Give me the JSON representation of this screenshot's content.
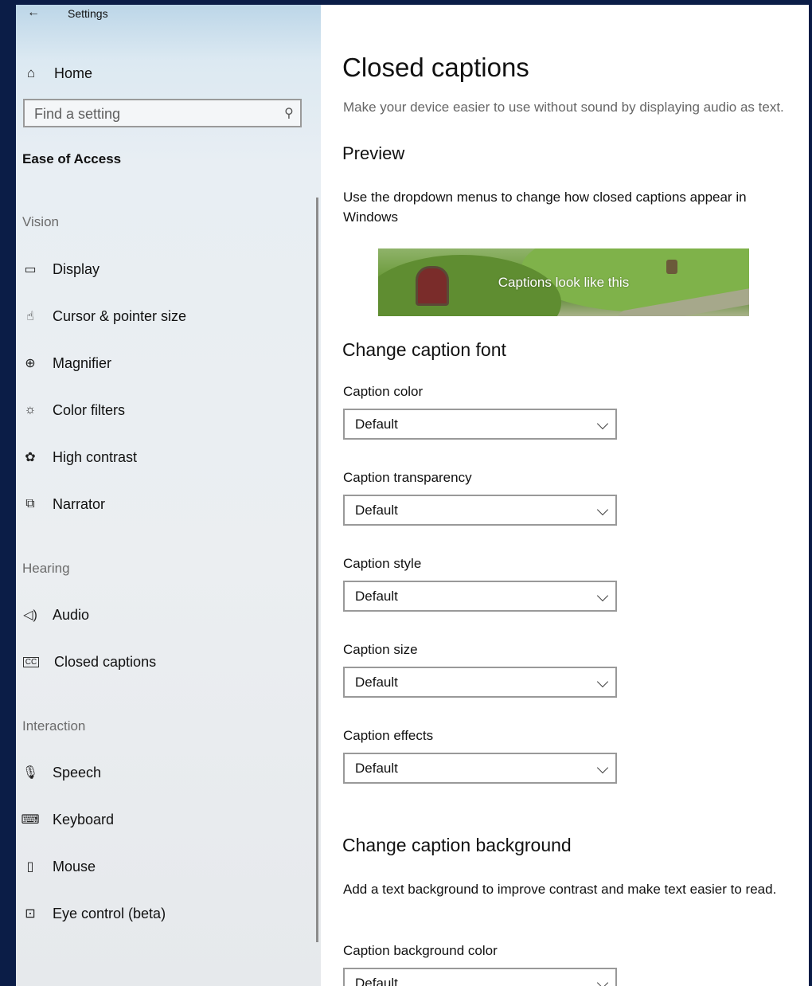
{
  "window": {
    "title": "Settings"
  },
  "sidebar": {
    "home_label": "Home",
    "search_placeholder": "Find a setting",
    "section_title": "Ease of Access",
    "groups": [
      {
        "heading": "Vision",
        "items": [
          {
            "label": "Display",
            "icon": "monitor-icon"
          },
          {
            "label": "Cursor & pointer size",
            "icon": "cursor-icon"
          },
          {
            "label": "Magnifier",
            "icon": "magnifier-icon"
          },
          {
            "label": "Color filters",
            "icon": "sun-icon"
          },
          {
            "label": "High contrast",
            "icon": "palette-icon"
          },
          {
            "label": "Narrator",
            "icon": "narrator-icon"
          }
        ]
      },
      {
        "heading": "Hearing",
        "items": [
          {
            "label": "Audio",
            "icon": "speaker-icon"
          },
          {
            "label": "Closed captions",
            "icon": "cc-icon"
          }
        ]
      },
      {
        "heading": "Interaction",
        "items": [
          {
            "label": "Speech",
            "icon": "microphone-icon"
          },
          {
            "label": "Keyboard",
            "icon": "keyboard-icon"
          },
          {
            "label": "Mouse",
            "icon": "mouse-icon"
          },
          {
            "label": "Eye control (beta)",
            "icon": "eye-control-icon"
          }
        ]
      }
    ]
  },
  "main": {
    "title": "Closed captions",
    "description": "Make your device easier to use without sound by displaying audio as text.",
    "preview_heading": "Preview",
    "preview_description": "Use the dropdown menus to change how closed captions appear in Windows",
    "preview_caption": "Captions look like this",
    "font_section": {
      "heading": "Change caption font",
      "fields": [
        {
          "label": "Caption color",
          "value": "Default"
        },
        {
          "label": "Caption transparency",
          "value": "Default"
        },
        {
          "label": "Caption style",
          "value": "Default"
        },
        {
          "label": "Caption size",
          "value": "Default"
        },
        {
          "label": "Caption effects",
          "value": "Default"
        }
      ]
    },
    "background_section": {
      "heading": "Change caption background",
      "description": "Add a text background to improve contrast and make text easier to read.",
      "fields": [
        {
          "label": "Caption background color",
          "value": "Default"
        }
      ]
    }
  }
}
